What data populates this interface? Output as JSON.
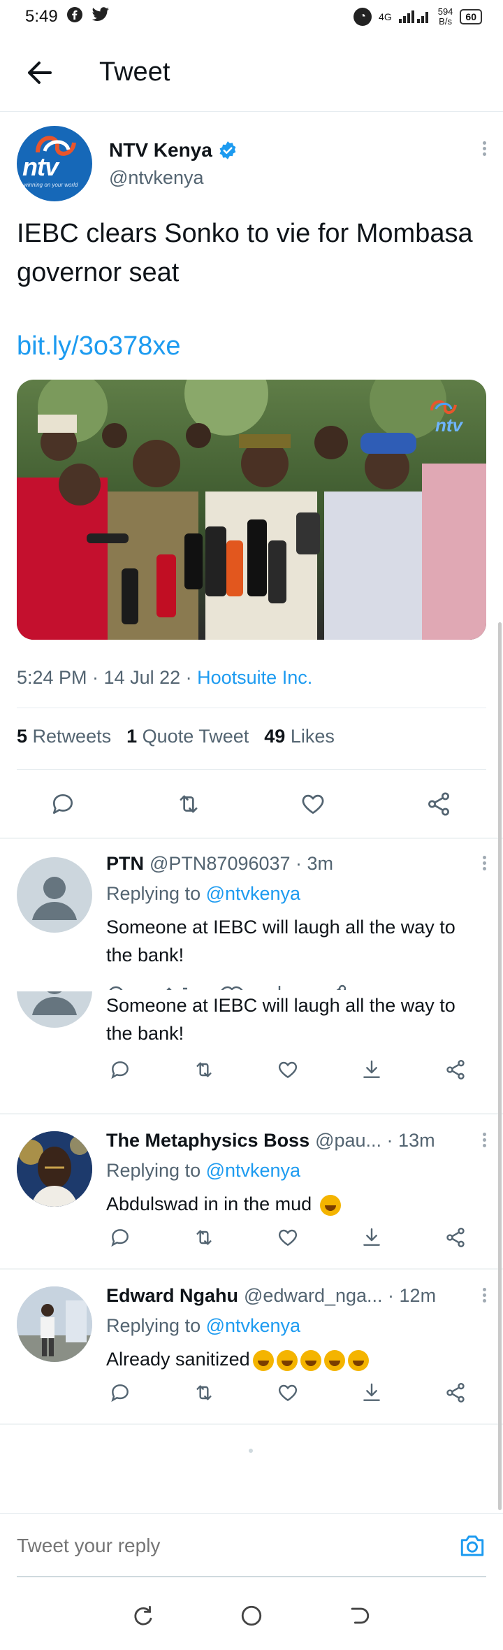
{
  "status_bar": {
    "time": "5:49",
    "network": "4G",
    "speed_value": "594",
    "speed_unit": "B/s",
    "battery": "60"
  },
  "header": {
    "title": "Tweet"
  },
  "tweet": {
    "author_name": "NTV Kenya",
    "author_handle": "@ntvkenya",
    "avatar_text": "ntv",
    "avatar_tagline": "winning on your world",
    "text": "IEBC clears Sonko to vie for Mombasa governor seat",
    "link": "bit.ly/3o378xe",
    "media_watermark": "ntv",
    "time": "5:24 PM · 14 Jul 22 · ",
    "source": "Hootsuite Inc.",
    "retweets_count": "5",
    "retweets_label": "Retweets",
    "quotes_count": "1",
    "quotes_label": "Quote Tweet",
    "likes_count": "49",
    "likes_label": "Likes"
  },
  "replies": [
    {
      "name": "PTN",
      "handle": "@PTN87096037 · 3m",
      "replying_label": "Replying to ",
      "replying_to": "@ntvkenya",
      "text": "Someone at IEBC will laugh all the way to the bank!",
      "text_repeat": "Someone at IEBC will laugh all the way to the bank!"
    },
    {
      "name": "The Metaphysics Boss",
      "handle": "@pau... · 13m",
      "replying_label": "Replying to ",
      "replying_to": "@ntvkenya",
      "text": "Abdulswad in in the mud"
    },
    {
      "name": "Edward Ngahu",
      "handle": "@edward_nga... · 12m",
      "replying_label": "Replying to ",
      "replying_to": "@ntvkenya",
      "text": "Already sanitized"
    }
  ],
  "composer": {
    "placeholder": "Tweet your reply"
  },
  "colors": {
    "accent": "#1d9bf0",
    "text": "#0f1419",
    "muted": "#536471"
  }
}
